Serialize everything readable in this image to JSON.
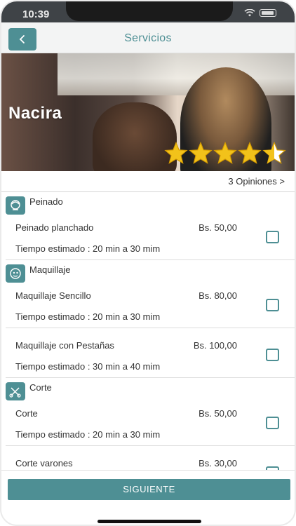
{
  "status_bar": {
    "time": "10:39"
  },
  "header": {
    "title": "Servicios",
    "back_label": "<"
  },
  "salon": {
    "name": "Nacira",
    "rating": 4.5,
    "rating_max": 5,
    "reviews_link": "3 Opiniones >"
  },
  "categories": [
    {
      "name": "Peinado",
      "icon": "hairstyle-icon",
      "items": [
        {
          "name": "Peinado planchado",
          "price": "Bs. 50,00",
          "time": "Tiempo estimado : 20 min a 30 mim",
          "checked": false
        }
      ]
    },
    {
      "name": "Maquillaje",
      "icon": "makeup-icon",
      "items": [
        {
          "name": "Maquillaje Sencillo",
          "price": "Bs. 80,00",
          "time": "Tiempo estimado : 20 min a 30 mim",
          "checked": false
        },
        {
          "name": "Maquillaje con Pestañas",
          "price": "Bs. 100,00",
          "time": "Tiempo estimado : 30 min a 40 mim",
          "checked": false
        }
      ]
    },
    {
      "name": "Corte",
      "icon": "scissors-comb-icon",
      "items": [
        {
          "name": "Corte",
          "price": "Bs. 50,00",
          "time": "Tiempo estimado : 20 min a 30 mim",
          "checked": false
        },
        {
          "name": "Corte varones",
          "price": "Bs. 30,00",
          "time": "",
          "checked": false
        }
      ]
    }
  ],
  "footer": {
    "next_label": "SIGUIENTE"
  },
  "colors": {
    "accent": "#4e8f94",
    "star": "#f2c21a"
  }
}
